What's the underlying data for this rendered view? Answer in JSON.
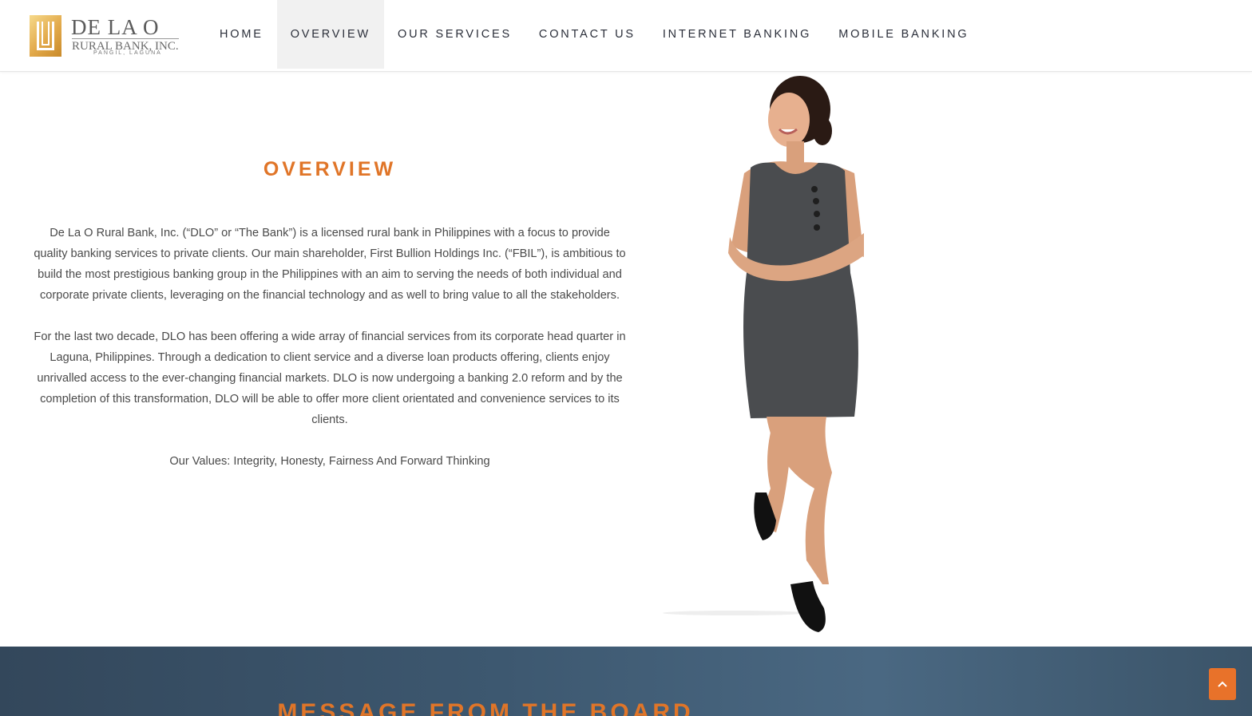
{
  "brand": {
    "name": "DE LA O",
    "subtitle": "RURAL BANK, INC.",
    "location": "PANGIL, LAGUNA"
  },
  "nav": {
    "items": [
      {
        "label": "HOME"
      },
      {
        "label": "OVERVIEW",
        "active": true
      },
      {
        "label": "OUR SERVICES"
      },
      {
        "label": "CONTACT US"
      },
      {
        "label": "INTERNET BANKING"
      },
      {
        "label": "MOBILE BANKING"
      }
    ]
  },
  "overview": {
    "title": "OVERVIEW",
    "paragraph1": "De La O Rural Bank, Inc. (“DLO” or “The Bank”) is a licensed rural bank in Philippines with a focus to provide quality banking services to private clients. Our main shareholder, First Bullion Holdings Inc. (“FBIL”), is ambitious to build the most prestigious banking group in the Philippines with an aim to serving the needs of both individual and corporate private clients, leveraging on the financial technology and as well to bring value to all the stakeholders.",
    "paragraph2": "For the last two decade, DLO has been offering a wide array of financial services from its corporate head quarter in Laguna, Philippines. Through a dedication to client service and a diverse loan products offering, clients enjoy unrivalled access to the ever-changing financial markets. DLO is now undergoing a banking 2.0 reform and by the completion of this transformation, DLO will be able to offer more client orientated and convenience services to its clients.",
    "values": "Our Values: Integrity, Honesty, Fairness And Forward Thinking"
  },
  "board_section": {
    "title": "MESSAGE FROM THE BOARD"
  },
  "colors": {
    "accent": "#e07528",
    "nav_text": "#2b2f3a",
    "band": "#3d5870"
  },
  "icons": {
    "scroll_top": "chevron-up-icon"
  }
}
